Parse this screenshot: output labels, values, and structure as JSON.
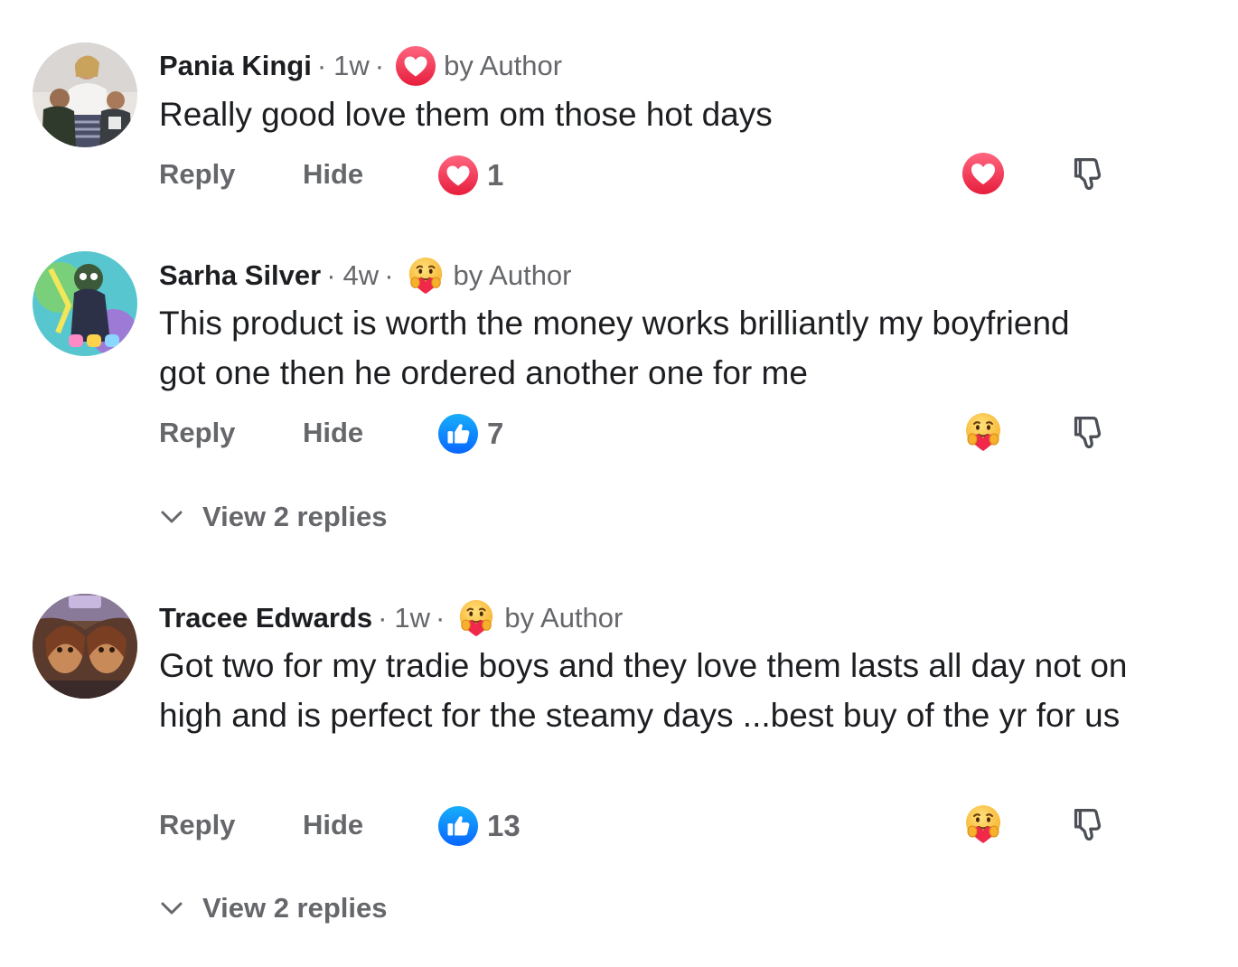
{
  "comments": [
    {
      "author": "Pania Kingi",
      "time": "1w",
      "author_reaction_icon": "love-heart-icon",
      "by_author": "by Author",
      "text": "Really good love them om those hot days",
      "reply_label": "Reply",
      "hide_label": "Hide",
      "reaction_icon": "love-heart-icon",
      "reaction_count": "1",
      "my_reaction_icon": "love-heart-icon",
      "view_replies": null
    },
    {
      "author": "Sarha Silver",
      "time": "4w",
      "author_reaction_icon": "care-hug-emoji-icon",
      "by_author": "by Author",
      "text": "This product is worth the money works brilliantly my boyfriend got one then he ordered another one for me",
      "reply_label": "Reply",
      "hide_label": "Hide",
      "reaction_icon": "like-thumb-icon",
      "reaction_count": "7",
      "my_reaction_icon": "care-hug-emoji-icon",
      "view_replies": "View 2 replies"
    },
    {
      "author": "Tracee Edwards",
      "time": "1w",
      "author_reaction_icon": "care-hug-emoji-icon",
      "by_author": "by Author",
      "text": "Got two for my tradie boys and they love them lasts all day not on high and is perfect for the steamy days ...best buy of the yr for us",
      "reply_label": "Reply",
      "hide_label": "Hide",
      "reaction_icon": "like-thumb-icon",
      "reaction_count": "13",
      "my_reaction_icon": "care-hug-emoji-icon",
      "view_replies": "View 2 replies"
    }
  ],
  "separator": "·",
  "colors": {
    "love": "#f0284a",
    "like": "#1877f2",
    "secondary_text": "#65676b",
    "primary_text": "#1c1e21"
  }
}
